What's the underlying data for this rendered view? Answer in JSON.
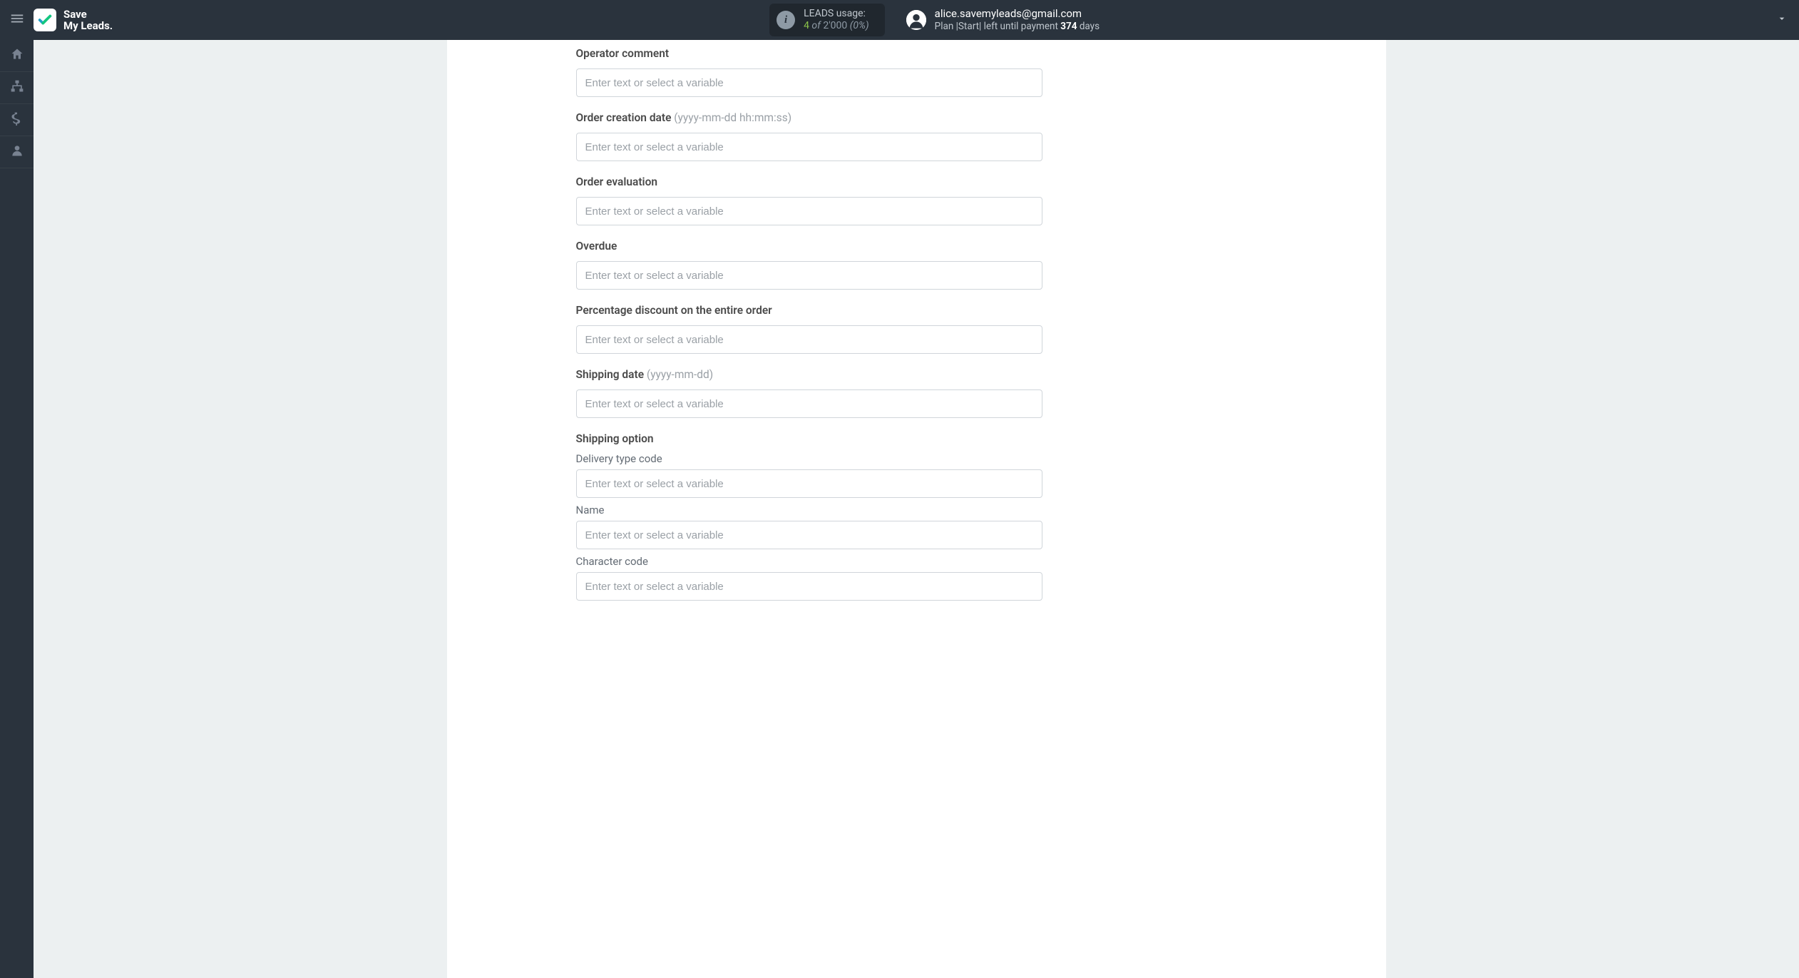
{
  "brand": {
    "line1": "Save",
    "line2": "My Leads."
  },
  "usage": {
    "title": "LEADS usage:",
    "used": "4",
    "of_word": " of ",
    "limit": "2'000",
    "pct": " (0%)"
  },
  "user": {
    "email": "alice.savemyleads@gmail.com",
    "plan_pre": "Plan |Start| left until payment ",
    "days": "374",
    "plan_post": " days"
  },
  "placeholder": "Enter text or select a variable",
  "fields": {
    "operator_comment": {
      "label": "Operator comment",
      "hint": ""
    },
    "order_creation_date": {
      "label": "Order creation date ",
      "hint": "(yyyy-mm-dd hh:mm:ss)"
    },
    "order_evaluation": {
      "label": "Order evaluation",
      "hint": ""
    },
    "overdue": {
      "label": "Overdue",
      "hint": ""
    },
    "percentage_discount": {
      "label": "Percentage discount on the entire order",
      "hint": ""
    },
    "shipping_date": {
      "label": "Shipping date ",
      "hint": "(yyyy-mm-dd)"
    },
    "shipping_option": {
      "label": "Shipping option",
      "subfields": {
        "delivery_type_code": "Delivery type code",
        "name": "Name",
        "character_code": "Character code"
      }
    }
  }
}
